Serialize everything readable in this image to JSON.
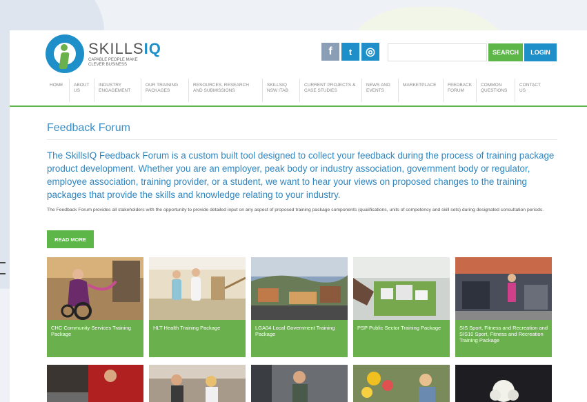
{
  "brand": {
    "name_light": "SKILLS",
    "name_bold": "IQ",
    "tagline": "CAPABLE PEOPLE MAKE CLEVER BUSINESS"
  },
  "social": [
    {
      "icon": "facebook-icon",
      "glyph": "f"
    },
    {
      "icon": "twitter-icon",
      "glyph": "t"
    },
    {
      "icon": "instagram-icon",
      "glyph": "◎"
    }
  ],
  "search": {
    "value": "",
    "placeholder": ""
  },
  "buttons": {
    "search": "SEARCH",
    "login": "LOGIN",
    "read_more": "READ MORE"
  },
  "nav": [
    "HOME",
    "ABOUT US",
    "INDUSTRY ENGAGEMENT",
    "OUR TRAINING PACKAGES",
    "RESOURCES, RESEARCH AND SUBMISSIONS",
    "SKILLSIQ NSW ITAB",
    "CURRENT PROJECTS & CASE STUDIES",
    "NEWS AND EVENTS",
    "MARKETPLACE",
    "FEEDBACK FORUM",
    "COMMON QUESTIONS",
    "CONTACT US"
  ],
  "page": {
    "title": "Feedback Forum",
    "intro": "The SkillsIQ Feedback Forum is a custom built tool designed to collect your feedback during the process of training package product development. Whether you are an employer, peak body or industry association, government body or regulator, employee association, training provider, or a student, we want to hear your views on proposed changes to the training packages that provide the skills and knowledge relating to your industry.",
    "body": "The Feedback Forum provides all stakeholders with the opportunity to provide detailed input on any aspect of proposed training package components (qualifications, units of competency and skill sets) during designated consultation periods."
  },
  "packages": [
    "CHC Community Services Training Package",
    "HLT Health Training Package",
    "LGA04 Local Government Training Package",
    "PSP Public Sector Training Package",
    "SIS Sport, Fitness and Recreation and SIS10 Sport, Fitness and Recreation Training Package"
  ],
  "colors": {
    "accent_green": "#5cb648",
    "brand_blue": "#1e8fc8",
    "label_green": "#6ab04c"
  }
}
